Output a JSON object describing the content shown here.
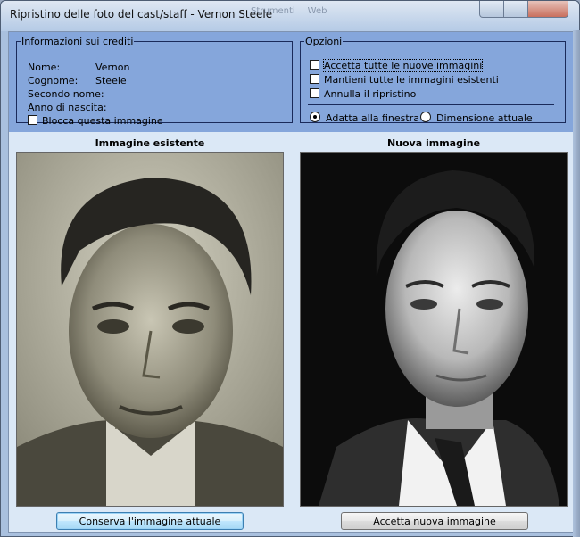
{
  "window": {
    "title": "Ripristino delle foto del cast/staff - Vernon Steele"
  },
  "credits": {
    "legend": "Informazioni sui crediti",
    "rows": [
      {
        "label": "Nome:",
        "value": "Vernon"
      },
      {
        "label": "Cognome:",
        "value": "Steele"
      },
      {
        "label": "Secondo nome:",
        "value": ""
      },
      {
        "label": "Anno di nascita:",
        "value": ""
      }
    ],
    "lock_label": "Blocca questa immagine",
    "lock_checked": false
  },
  "options": {
    "legend": "Opzioni",
    "checkboxes": [
      {
        "label": "Accetta tutte le nuove immagini",
        "checked": false
      },
      {
        "label": "Mantieni tutte le immagini esistenti",
        "checked": false
      },
      {
        "label": "Annulla il ripristino",
        "checked": false
      }
    ],
    "radios": [
      {
        "label": "Adatta alla finestra",
        "checked": true
      },
      {
        "label": "Dimensione attuale",
        "checked": false
      }
    ]
  },
  "existing": {
    "heading": "Immagine esistente",
    "button_label": "Conserva l'immagine attuale",
    "photo_icon": "portrait-photo"
  },
  "new_image": {
    "heading": "Nuova immagine",
    "button_label": "Accetta nuova immagine",
    "photo_icon": "portrait-photo"
  }
}
